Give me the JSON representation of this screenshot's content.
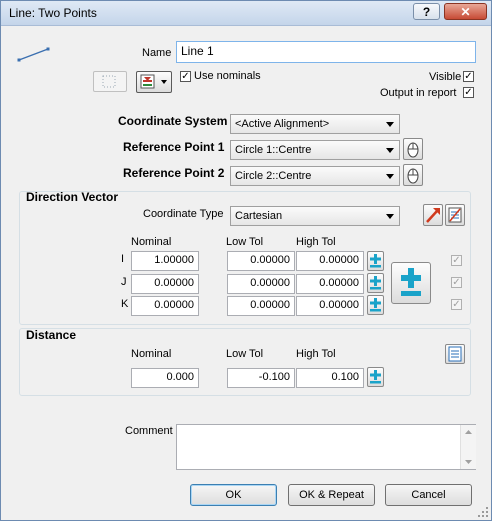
{
  "window": {
    "title": "Line: Two Points",
    "help_label": "?",
    "close_label": "✕"
  },
  "name": {
    "label": "Name",
    "value": "Line 1"
  },
  "options": {
    "use_nominals_label": "Use nominals",
    "use_nominals_checked": true,
    "visible_label": "Visible",
    "visible_checked": true,
    "output_label": "Output in report",
    "output_checked": true
  },
  "coordinate_system": {
    "label": "Coordinate System",
    "value": "<Active Alignment>"
  },
  "reference_point_1": {
    "label": "Reference Point 1",
    "value": "Circle 1::Centre"
  },
  "reference_point_2": {
    "label": "Reference Point 2",
    "value": "Circle 2::Centre"
  },
  "direction_vector": {
    "title": "Direction Vector",
    "coordinate_type_label": "Coordinate Type",
    "coordinate_type_value": "Cartesian",
    "headers": {
      "nominal": "Nominal",
      "low_tol": "Low Tol",
      "high_tol": "High Tol"
    },
    "rows": [
      {
        "axis": "I",
        "nominal": "1.00000",
        "low_tol": "0.00000",
        "high_tol": "0.00000"
      },
      {
        "axis": "J",
        "nominal": "0.00000",
        "low_tol": "0.00000",
        "high_tol": "0.00000"
      },
      {
        "axis": "K",
        "nominal": "0.00000",
        "low_tol": "0.00000",
        "high_tol": "0.00000"
      }
    ]
  },
  "distance": {
    "title": "Distance",
    "headers": {
      "nominal": "Nominal",
      "low_tol": "Low Tol",
      "high_tol": "High Tol"
    },
    "nominal": "0.000",
    "low_tol": "-0.100",
    "high_tol": "0.100"
  },
  "comment": {
    "label": "Comment",
    "value": ""
  },
  "buttons": {
    "ok": "OK",
    "ok_repeat": "OK & Repeat",
    "cancel": "Cancel"
  },
  "colors": {
    "accent_cyan": "#1aa3c9",
    "red_arrow": "#d03a1e",
    "check_mark": "#000000"
  }
}
